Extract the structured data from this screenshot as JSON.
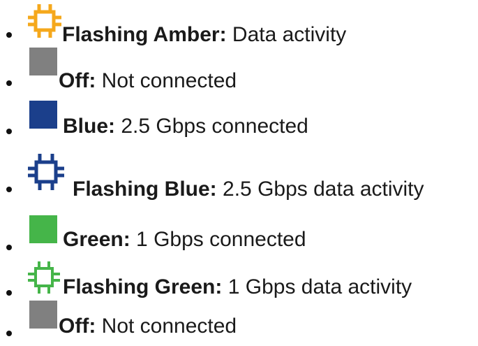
{
  "led_legend": {
    "items": [
      {
        "icon": "flashing-square-icon",
        "color": "#f5a81c",
        "status": "Flashing Amber:",
        "description": "Data activity"
      },
      {
        "icon": "solid-square-icon",
        "color": "#808080",
        "status": "Off:",
        "description": "Not connected"
      },
      {
        "icon": "solid-square-icon",
        "color": "#1b3f8b",
        "status": "Blue:",
        "description": "2.5 Gbps connected"
      },
      {
        "icon": "flashing-square-icon",
        "color": "#1b3f8b",
        "status": "Flashing Blue:",
        "description": "2.5 Gbps data activity"
      },
      {
        "icon": "solid-square-icon",
        "color": "#45b549",
        "status": "Green:",
        "description": "1 Gbps connected"
      },
      {
        "icon": "flashing-square-icon",
        "color": "#45b549",
        "status": "Flashing Green:",
        "description": "1 Gbps data activity"
      },
      {
        "icon": "solid-square-icon",
        "color": "#808080",
        "status": "Off:",
        "description": "Not connected"
      }
    ]
  }
}
